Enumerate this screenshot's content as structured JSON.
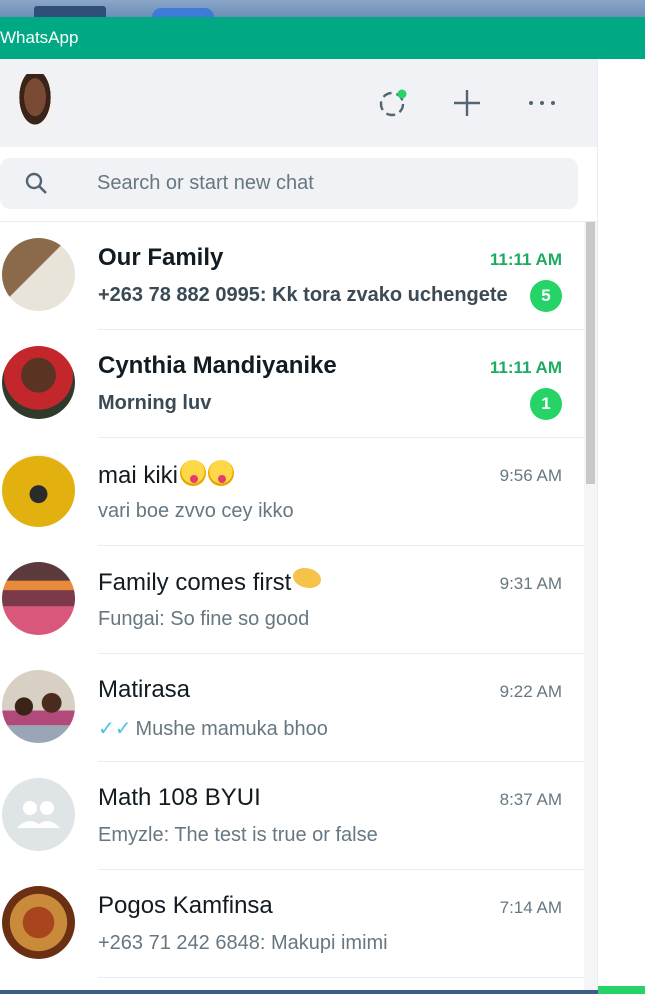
{
  "window": {
    "title": "WhatsApp"
  },
  "header": {
    "profile_avatar": "profile-photo",
    "icons": [
      "status-icon",
      "new-chat-icon",
      "menu-icon"
    ]
  },
  "search": {
    "placeholder": "Search or start new chat",
    "value": ""
  },
  "colors": {
    "brand": "#00a884",
    "unread": "#25d366",
    "read_ticks": "#53bdeb"
  },
  "chats": [
    {
      "name": "Our Family",
      "time": "11:11 AM",
      "message": "+263 78 882 0995: Kk tora zvako uchengete",
      "unread": "5",
      "avatar": "group-photo-religious-image"
    },
    {
      "name": "Cynthia Mandiyanike",
      "time": "11:11 AM",
      "message": "Morning luv",
      "unread": "1",
      "avatar": "person-photo-red-top"
    },
    {
      "name": "mai kiki",
      "name_emoji": [
        "zany-face-emoji",
        "zany-face-emoji"
      ],
      "time": "9:56 AM",
      "message": "vari boe zvvo cey ikko",
      "avatar": "yellow-tshirt-africa-map"
    },
    {
      "name": "Family comes first",
      "name_emoji": [
        "handshake-emoji"
      ],
      "time": "9:31 AM",
      "message": "Fungai: So fine so good",
      "avatar": "tulip-field-sunset"
    },
    {
      "name": "Matirasa",
      "time": "9:22 AM",
      "message": "Mushe mamuka bhoo",
      "read_ticks": true,
      "avatar": "two-children-photo"
    },
    {
      "name": "Math 108 BYUI",
      "time": "8:37 AM",
      "message": "Emyzle: The test is true or false",
      "avatar": "default-group-icon"
    },
    {
      "name": "Pogos Kamfinsa",
      "time": "7:14 AM",
      "message": "+263 71 242 6848: Makupi imimi",
      "avatar": "food-platter-photo"
    }
  ]
}
